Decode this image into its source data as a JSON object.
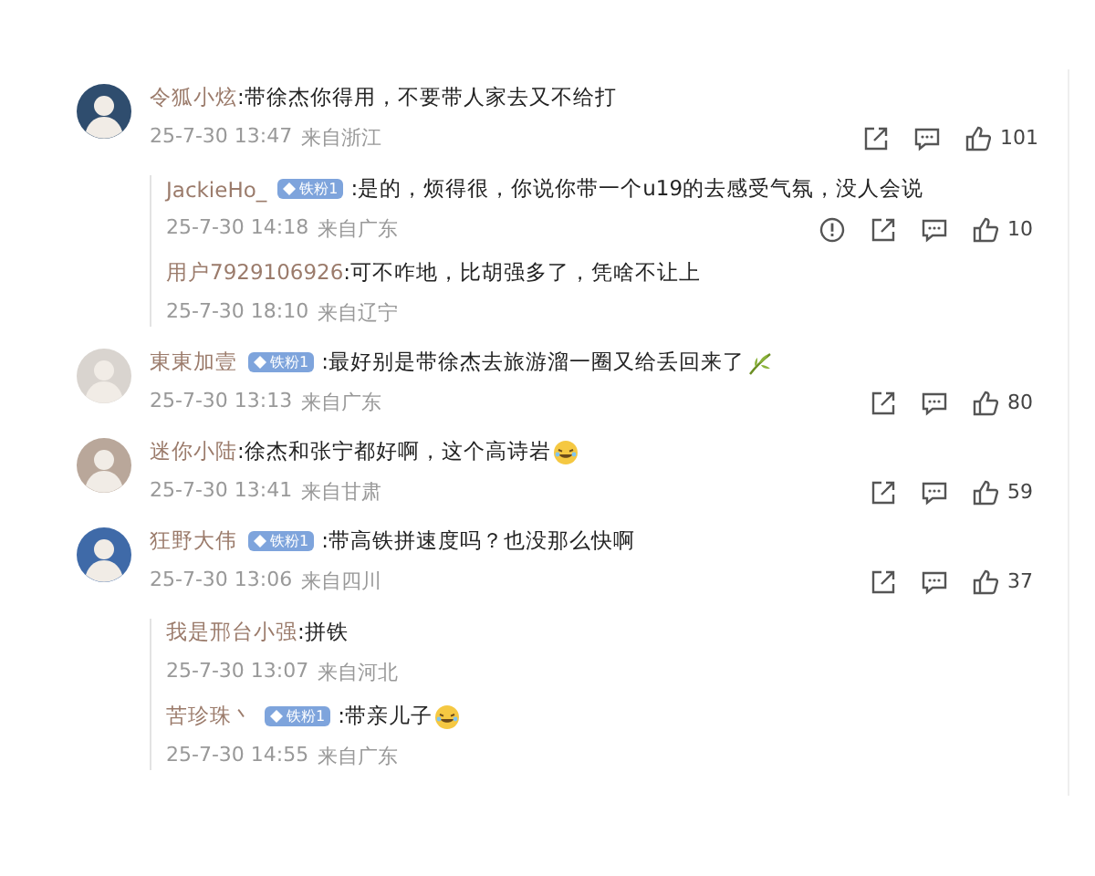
{
  "comments": [
    {
      "name": "令狐小炫",
      "text": ":带徐杰你得用，不要带人家去又不给打",
      "time": "25-7-30 13:47",
      "location": "来自浙江",
      "has_actions": true,
      "likes": "101",
      "replies": [
        {
          "name": "JackieHo_",
          "badge": "铁粉1",
          "text": ":是的，烦得很，你说你带一个u19的去感受气氛，没人会说",
          "time": "25-7-30 14:18",
          "location": "来自广东",
          "has_actions": true,
          "reportable": true,
          "likes": "10"
        },
        {
          "name": "用户7929106926",
          "text": ":可不咋地，比胡强多了，凭啥不让上",
          "time": "25-7-30 18:10",
          "location": "来自辽宁"
        }
      ]
    },
    {
      "name": "東東加壹",
      "badge": "铁粉1",
      "text": ":最好别是带徐杰去旅游溜一圈又给丢回来了",
      "emoji": {
        "kind": "leaf"
      },
      "time": "25-7-30 13:13",
      "location": "来自广东",
      "has_actions": true,
      "likes": "80"
    },
    {
      "name": "迷你小陆",
      "text": ":徐杰和张宁都好啊，这个高诗岩",
      "emoji": {
        "kind": "laugh"
      },
      "time": "25-7-30 13:41",
      "location": "来自甘肃",
      "has_actions": true,
      "likes": "59"
    },
    {
      "name": "狂野大伟",
      "badge": "铁粉1",
      "text": ":带高铁拼速度吗？也没那么快啊",
      "time": "25-7-30 13:06",
      "location": "来自四川",
      "has_actions": true,
      "likes": "37",
      "replies": [
        {
          "name": "我是邢台小强",
          "text": ":拼铁",
          "time": "25-7-30 13:07",
          "location": "来自河北"
        },
        {
          "name": "苦珍珠丶",
          "badge": "铁粉1",
          "text": ":带亲儿子",
          "emoji": {
            "kind": "laugh"
          },
          "time": "25-7-30 14:55",
          "location": "来自广东"
        }
      ]
    }
  ]
}
